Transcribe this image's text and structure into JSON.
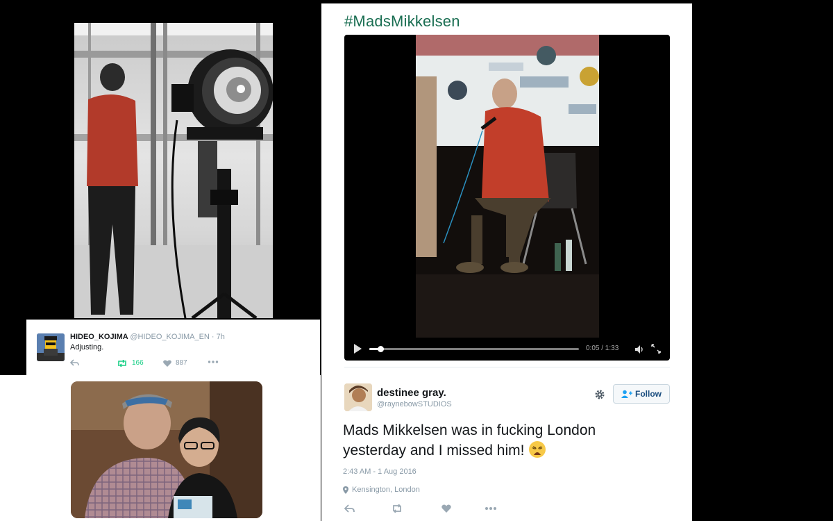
{
  "video_tweet": {
    "hashtag": "#MadsMikkelsen",
    "video": {
      "current_time": "0:05",
      "duration": "1:33",
      "time_label": "0:05 / 1:33",
      "progress_percent": 5.4
    },
    "author": {
      "name": "destinee gray.",
      "handle": "@raynebowSTUDIOS"
    },
    "follow_label": "Follow",
    "text": "Mads Mikkelsen was in fucking London yesterday and I missed him!",
    "emoji_icon": "weary-face-emoji",
    "timestamp": "2:43 AM - 1 Aug 2016",
    "location": "Kensington, London"
  },
  "kojima_tweet": {
    "name": "HIDEO_KOJIMA",
    "handle_time": "@HIDEO_KOJIMA_EN · 7h",
    "text": "Adjusting.",
    "retweets": "166",
    "likes": "887"
  },
  "colors": {
    "hashtag": "#1a6e52",
    "retweet_active": "#19cf86",
    "follow_text": "#1a4d7f",
    "muted": "#8899a6"
  }
}
